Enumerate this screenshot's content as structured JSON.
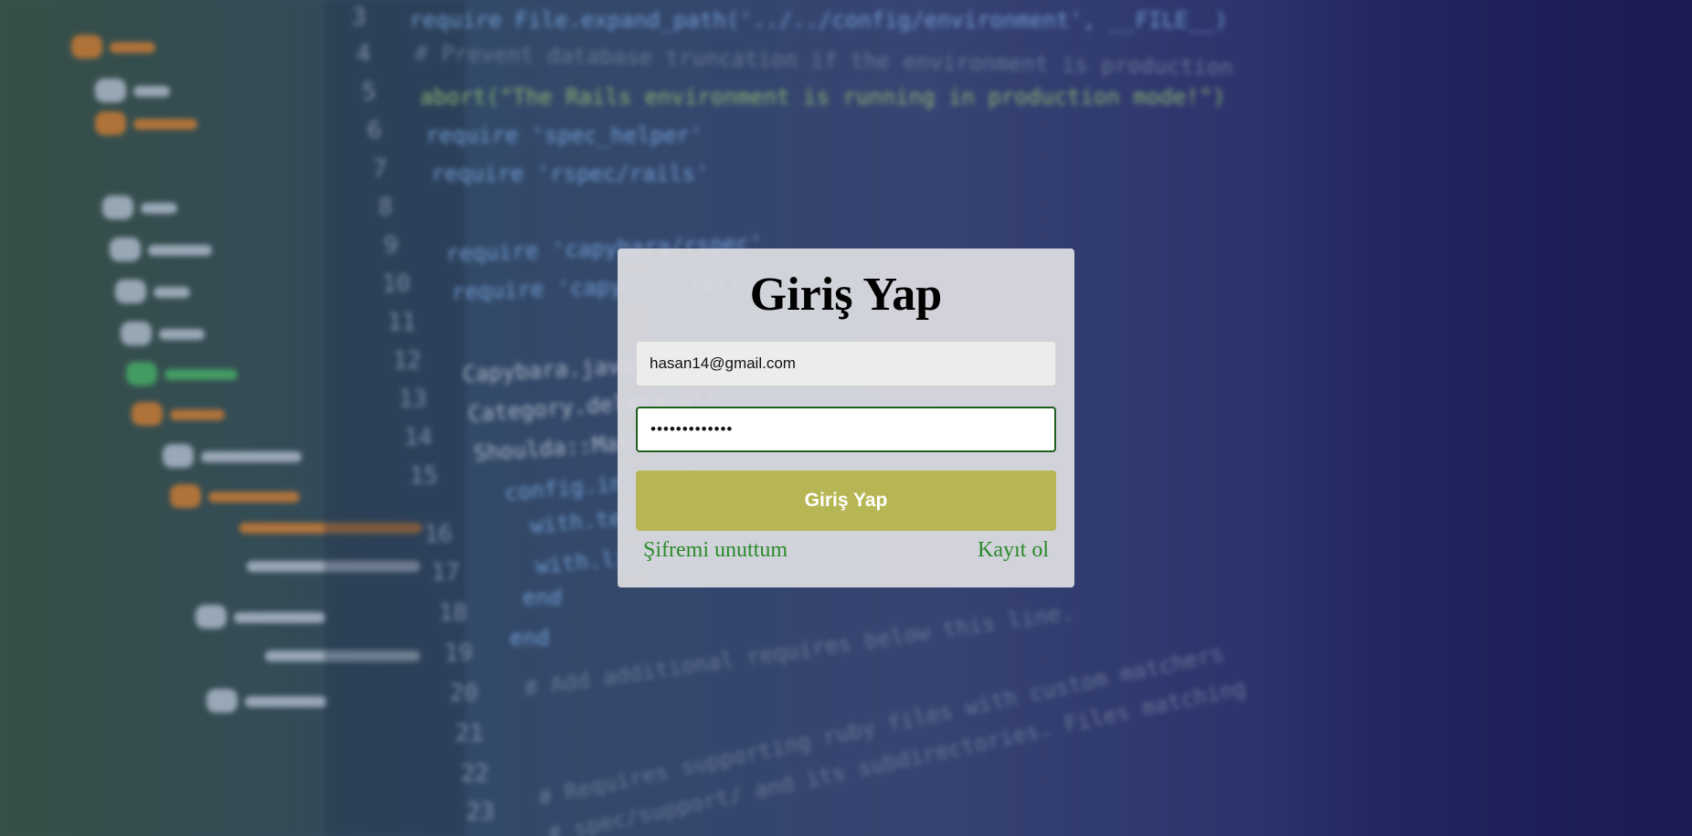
{
  "login": {
    "title": "Giriş Yap",
    "email_value": "hasan14@gmail.com",
    "password_value": "•••••••••••••",
    "submit_label": "Giriş Yap",
    "forgot_password_label": "Şifremi unuttum",
    "register_label": "Kayıt ol"
  },
  "background": {
    "line_numbers": [
      "3",
      "4",
      "5",
      "6",
      "7",
      "8",
      "9",
      "10",
      "11",
      "12",
      "13",
      "14",
      "15",
      "16",
      "17",
      "18",
      "19",
      "20",
      "21",
      "22",
      "23"
    ],
    "code_lines": [
      "require File.expand_path('../../config/environment', __FILE__)",
      "# Prevent database truncation if the environment is production",
      "abort(\"The Rails environment is running in production mode!\")",
      "require 'spec_helper'",
      "require 'rspec/rails'",
      "require 'capybara/rspec'",
      "require 'capybara/rails'",
      "Capybara.javascript_driver",
      "Category.delete_all",
      "Shoulda::Matchers",
      "config.integrate",
      "with.test",
      "with.library",
      "end",
      "end",
      "# Add additional requires below this line.",
      "# Requires supporting ruby files with custom matchers",
      "# spec/support/ and its subdirectories. Files matching"
    ]
  },
  "colors": {
    "card_bg": "#dedee2",
    "button_bg": "#b7b655",
    "link_color": "#2a8a2a",
    "password_border": "#1e5e1e"
  }
}
